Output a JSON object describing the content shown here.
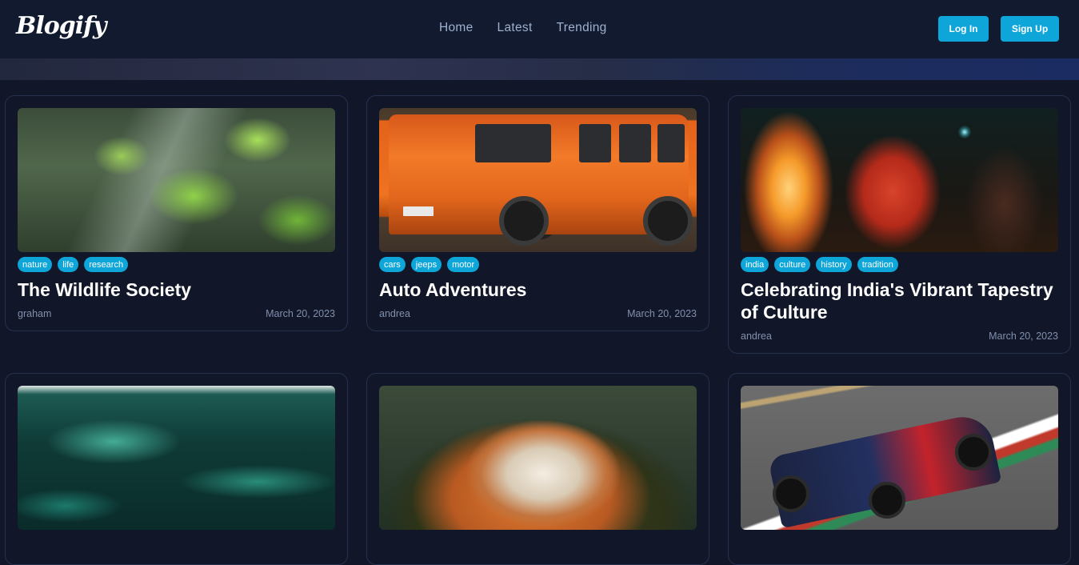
{
  "header": {
    "logo": "Blogify",
    "nav": [
      "Home",
      "Latest",
      "Trending"
    ],
    "login_label": "Log In",
    "signup_label": "Sign Up"
  },
  "colors": {
    "background": "#111729",
    "accent": "#0ea5d9",
    "muted_text": "#8090ad",
    "nav_text": "#9fb1cf"
  },
  "posts": [
    {
      "image": "forest-sunlight-image",
      "tags": [
        "nature",
        "life",
        "research"
      ],
      "title": "The Wildlife Society",
      "author": "graham",
      "date": "March 20, 2023"
    },
    {
      "image": "orange-suv-image",
      "tags": [
        "cars",
        "jeeps",
        "motor"
      ],
      "title": "Auto Adventures",
      "author": "andrea",
      "date": "March 20, 2023"
    },
    {
      "image": "indian-festival-image",
      "tags": [
        "india",
        "culture",
        "history",
        "tradition"
      ],
      "title": "Celebrating India's Vibrant Tapestry of Culture",
      "author": "andrea",
      "date": "March 20, 2023"
    },
    {
      "image": "ocean-waves-image"
    },
    {
      "image": "spaghetti-plate-image"
    },
    {
      "image": "formula-one-car-image"
    }
  ]
}
